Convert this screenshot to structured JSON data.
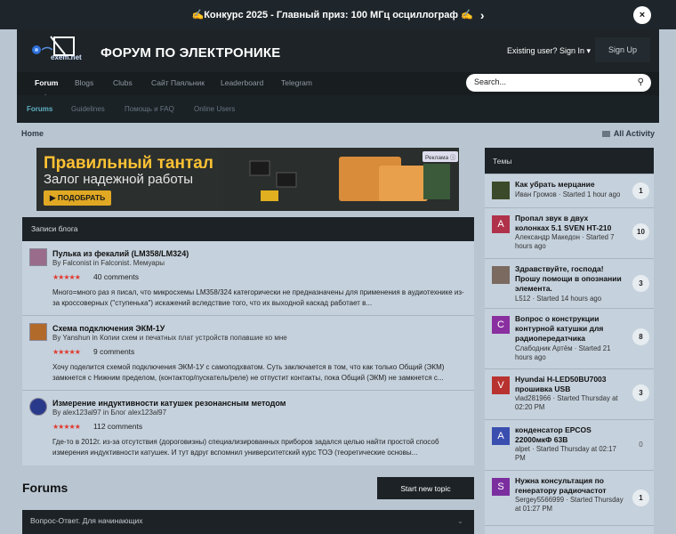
{
  "announcement": {
    "text": "✍️Конкурс 2025 - Главный приз: 100 МГц осциллограф ✍️",
    "close": "×",
    "chev": "›"
  },
  "header": {
    "logo_text": "exem.net",
    "brand": "ФОРУМ ПО ЭЛЕКТРОНИКЕ",
    "signin": "Existing user? Sign In ▾",
    "signup": "Sign Up"
  },
  "nav": {
    "items": [
      "Forum",
      "Blogs",
      "Clubs",
      "Сайт Паяльник",
      "Leaderboard",
      "Telegram"
    ],
    "search_placeholder": "Search..."
  },
  "subnav": {
    "items": [
      "Forums",
      "Guidelines",
      "Помощь и FAQ",
      "Online Users"
    ]
  },
  "breadcrumb": {
    "home": "Home",
    "all_activity": "All Activity"
  },
  "banner": {
    "line1": "Правильный тантал",
    "line2": "Залог надежной работы",
    "button": "▶ ПОДОБРАТЬ",
    "ad": "Реклама ⓘ"
  },
  "blog": {
    "title": "Записи блога",
    "posts": [
      {
        "title": "Пулька из фекалий (LM358/LM324)",
        "by": "By Falconist in Falconist. Мемуары",
        "stars": "★★★★★",
        "comments": "40 comments",
        "text": "Много=много раз я писал, что микросхемы LM358/324 категорически не предназначены для применения в аудиотехнике из-за кроссоверных (\"ступенька\") искажений вследствие того, что их выходной каскад работает в..."
      },
      {
        "title": "Схема подключения ЭКМ-1У",
        "by": "By Yanshun in Копии схем и печатных плат устройств попавшие ко мне",
        "stars": "★★★★★",
        "comments": "9 comments",
        "text": "Хочу поделится схемой подключения ЭКМ-1У с самоподхватом. Суть заключается в том, что как только Общий (ЭКМ) замкнется с Нижним пределом, (контактор/пускатель/реле) не отпустит контакты, пока Общий (ЭКМ) не замкнется с..."
      },
      {
        "title": "Измерение индуктивности катушек резонансным методом",
        "by": "By alex123al97 in Блог alex123al97",
        "stars": "★★★★★",
        "comments": "112 comments",
        "text": "Где-то в 2012г. из-за отсутствия (дороговизны) специализированных приборов задался целью найти простой способ измерения индуктивности катушек. И тут вдруг вспомнил университетский курс ТОЭ (теоретические основы..."
      }
    ]
  },
  "forums": {
    "title": "Forums",
    "start_topic": "Start new topic",
    "category": "Вопрос-Ответ. Для начинающих"
  },
  "sidebar": {
    "title": "Темы",
    "topics": [
      {
        "title": "Как убрать мерцание",
        "meta": "Иван Громов · Started 1 hour ago",
        "count": "1",
        "avatar": "",
        "color": "#3b4a2a"
      },
      {
        "title": "Пропал звук в двух колонках 5.1 SVEN HT-210",
        "meta": "Александр Македон · Started 7 hours ago",
        "count": "10",
        "avatar": "A",
        "color": "#b0314a"
      },
      {
        "title": "Здравствуйте, господа! Прошу помощи в опознании элемента.",
        "meta": "L512 · Started 14 hours ago",
        "count": "3",
        "avatar": "",
        "color": "#7a6a60"
      },
      {
        "title": "Вопрос о конструкции контурной катушки для радиопередатчика",
        "meta": "Слабодник Артём · Started 21 hours ago",
        "count": "8",
        "avatar": "C",
        "color": "#8a2fa0"
      },
      {
        "title": "Hyundai H-LED50BU7003 прошивка USB",
        "meta": "vlad281966 · Started Thursday at 02:20 PM",
        "count": "3",
        "avatar": "V",
        "color": "#b8322f"
      },
      {
        "title": "конденсатор EPCOS 22000мкФ 63В",
        "meta": "alpet · Started Thursday at 02:17 PM",
        "count": "0",
        "avatar": "A",
        "color": "#3a4eb0"
      },
      {
        "title": "Нужна консультация по генератору радиочастот",
        "meta": "Sergey5566999 · Started Thursday at 01:27 PM",
        "count": "1",
        "avatar": "S",
        "color": "#7b2f9f"
      }
    ]
  }
}
